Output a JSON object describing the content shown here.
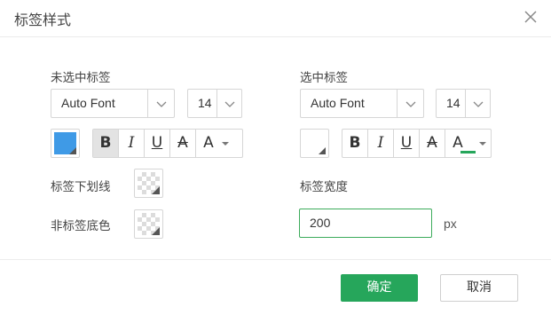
{
  "dialog": {
    "title": "标签样式",
    "close_icon": "close-icon"
  },
  "unselected": {
    "label": "未选中标签",
    "font": "Auto Font",
    "size": "14",
    "color": "#3f9ae6",
    "format": {
      "bold": "B",
      "italic": "I",
      "underline": "U",
      "strike": "A",
      "font_color": "A"
    },
    "bold_active": true
  },
  "selected": {
    "label": "选中标签",
    "font": "Auto Font",
    "size": "14",
    "format": {
      "bold": "B",
      "italic": "I",
      "underline": "U",
      "strike": "A",
      "font_color": "A"
    },
    "font_color_underline": "#26a65b"
  },
  "underline_label": "标签下划线",
  "unselected_bg_label": "非标签底色",
  "width": {
    "label": "标签宽度",
    "value": "200",
    "unit": "px"
  },
  "footer": {
    "ok": "确定",
    "cancel": "取消"
  },
  "colors": {
    "accent": "#26a65b",
    "input_border": "#3cab5b"
  }
}
